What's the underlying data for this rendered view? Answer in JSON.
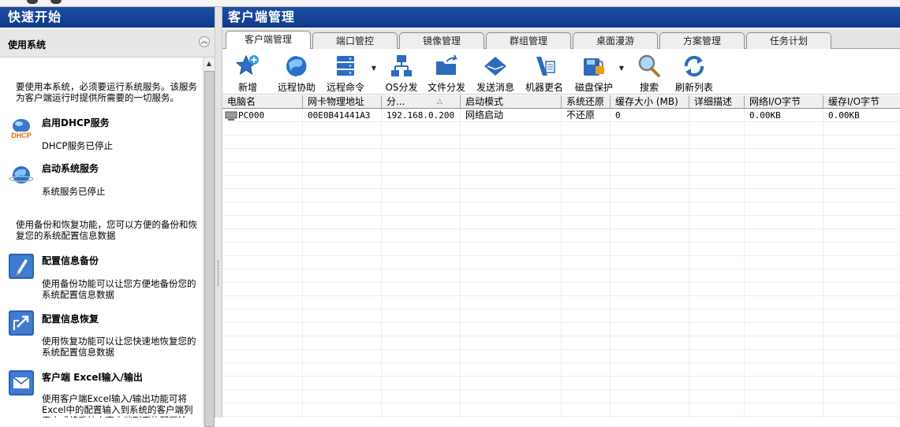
{
  "left_panel": {
    "title": "快速开始",
    "section_title": "使用系统",
    "intro_text": "要使用本系统，必须要运行系统服务。该服务为客户端运行时提供所需要的一切服务。",
    "tasks_services": [
      {
        "title": "启用DHCP服务",
        "desc": "DHCP服务已停止",
        "icon": "dhcp-icon"
      },
      {
        "title": "启动系统服务",
        "desc": "系统服务已停止",
        "icon": "globe-icon"
      }
    ],
    "backup_intro": "使用备份和恢复功能，您可以方便的备份和恢复您的系统配置信息数据",
    "tasks_backup": [
      {
        "title": "配置信息备份",
        "desc": "使用备份功能可以让您方便地备份您的系统配置信息数据",
        "icon": "pen-edit-icon"
      },
      {
        "title": "配置信息恢复",
        "desc": "使用恢复功能可以让您快速地恢复您的系统配置信息数据",
        "icon": "restore-arrow-icon"
      },
      {
        "title": "客户端 Excel输入/输出",
        "desc": "使用客户端Excel输入/输出功能可将Excel中的配置输入到系统的客户端列表中或将系统中客户端列表的配置输",
        "icon": "envelope-icon"
      }
    ]
  },
  "right_panel": {
    "title": "客户端管理",
    "tabs": [
      "客户端管理",
      "端口管控",
      "镜像管理",
      "群组管理",
      "桌面漫游",
      "方案管理",
      "任务计划"
    ],
    "active_tab": 0,
    "toolbar": [
      {
        "label": "新增",
        "icon": "star-add-icon"
      },
      {
        "label": "远程协助",
        "icon": "remote-globe-icon"
      },
      {
        "label": "远程命令",
        "icon": "server-icon"
      },
      {
        "label": "OS分发",
        "icon": "network-icon"
      },
      {
        "label": "文件分发",
        "icon": "folder-share-icon"
      },
      {
        "label": "发送消息",
        "icon": "message-envelope-icon"
      },
      {
        "label": "机器更名",
        "icon": "rename-icon"
      },
      {
        "label": "磁盘保护",
        "icon": "disk-lock-icon"
      },
      {
        "label": "搜索",
        "icon": "magnifier-icon"
      },
      {
        "label": "刷新列表",
        "icon": "refresh-icon"
      }
    ],
    "columns": [
      "电脑名",
      "网卡物理地址",
      "分...",
      "启动模式",
      "系统还原",
      "缓存大小 (MB)",
      "详细描述",
      "网络I/O字节",
      "缓存I/O字节"
    ],
    "rows": [
      {
        "name": "PC000",
        "mac": "00E0B41441A3",
        "ip": "192.168.0.200",
        "boot_mode": "网络启动",
        "restore": "不还原",
        "cache_size": "0",
        "desc": "",
        "net_io": "0.00KB",
        "cache_io": "0.00KB"
      }
    ]
  },
  "colors": {
    "title_bar": "#14439a",
    "panel_bg": "#e7e7e7",
    "grid_line": "#ececec"
  }
}
